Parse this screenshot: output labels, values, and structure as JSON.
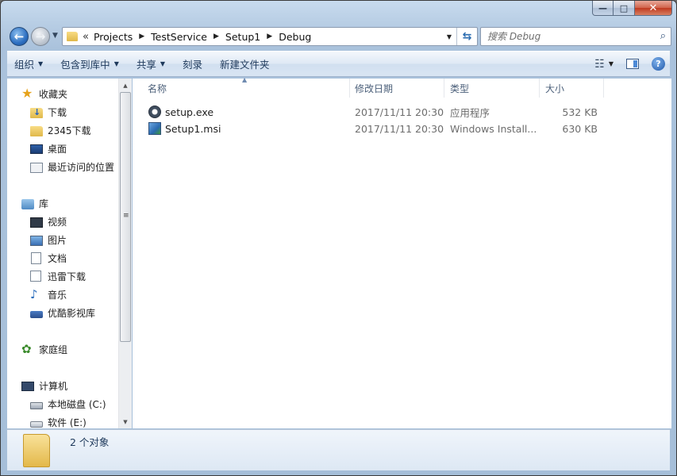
{
  "titlebar": {
    "minimize_glyph": "—",
    "maximize_glyph": "□",
    "close_glyph": "✕"
  },
  "address": {
    "chevron": "«",
    "breadcrumbs": [
      "Projects",
      "TestService",
      "Setup1",
      "Debug"
    ],
    "separator": "▶"
  },
  "search": {
    "placeholder": "搜索 Debug"
  },
  "toolbar": {
    "organize": "组织",
    "include_in_library": "包含到库中",
    "share": "共享",
    "burn": "刻录",
    "new_folder": "新建文件夹"
  },
  "sidebar": {
    "favorites": "收藏夹",
    "downloads": "下载",
    "dl2345": "2345下载",
    "desktop": "桌面",
    "recent": "最近访问的位置",
    "libraries": "库",
    "videos": "视频",
    "pictures": "图片",
    "documents": "文档",
    "thunder": "迅雷下载",
    "music": "音乐",
    "youku": "优酷影视库",
    "homegroup": "家庭组",
    "computer": "计算机",
    "local_disk_c": "本地磁盘 (C:)",
    "software_e": "软件 (E:)"
  },
  "columns": {
    "name": "名称",
    "modified": "修改日期",
    "type": "类型",
    "size": "大小"
  },
  "files": [
    {
      "name": "setup.exe",
      "modified": "2017/11/11 20:30",
      "type": "应用程序",
      "size": "532 KB",
      "icon": "exe-icon"
    },
    {
      "name": "Setup1.msi",
      "modified": "2017/11/11 20:30",
      "type": "Windows Install...",
      "size": "630 KB",
      "icon": "msi-icon"
    }
  ],
  "status": {
    "item_count": "2 个对象"
  }
}
